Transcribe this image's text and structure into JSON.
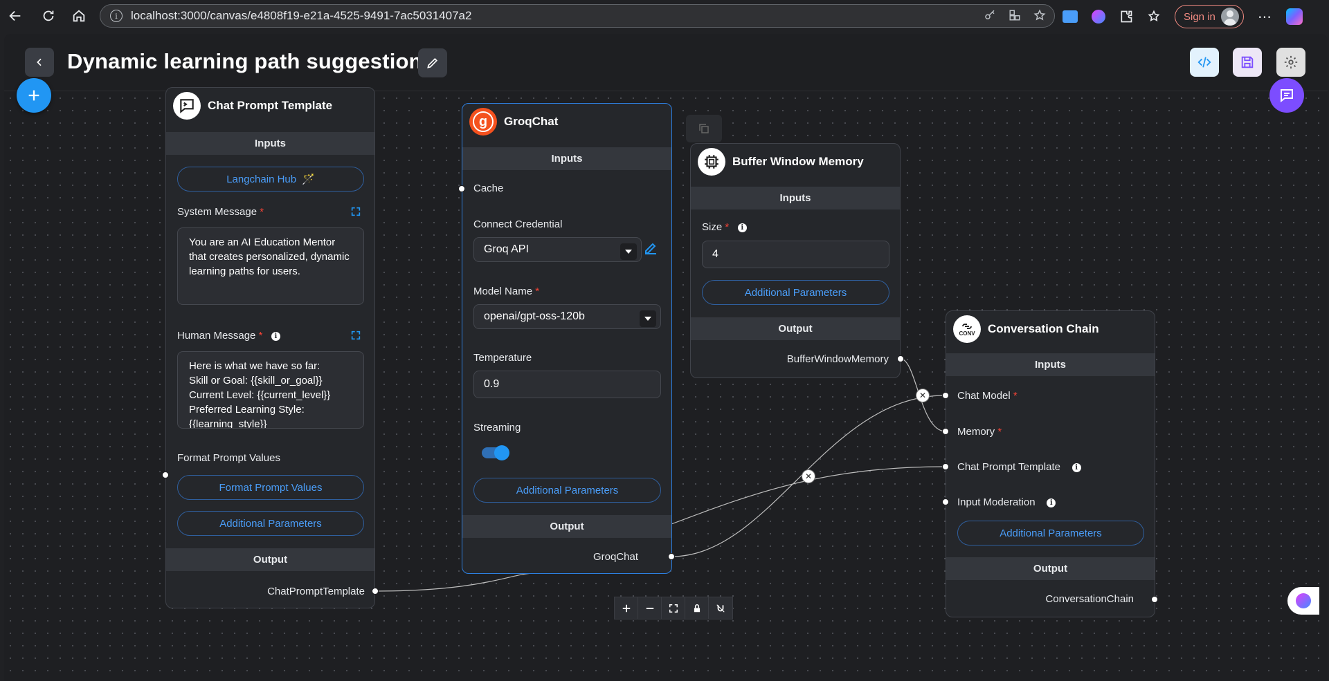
{
  "browser": {
    "url": "localhost:3000/canvas/e4808f19-e21a-4525-9491-7ac5031407a2",
    "signin_label": "Sign in"
  },
  "header": {
    "title": "Dynamic learning path suggestion"
  },
  "nodes": {
    "chat_prompt": {
      "title": "Chat Prompt Template",
      "inputs_label": "Inputs",
      "langchain_hub_label": "Langchain Hub",
      "system_message_label": "System Message",
      "system_message_value": "You are an AI Education Mentor that creates personalized, dynamic learning paths for users.",
      "human_message_label": "Human Message",
      "human_message_value": "Here is what we have so far:\nSkill or Goal: {{skill_or_goal}}\nCurrent Level: {{current_level}}\nPreferred Learning Style:\n{{learning_style}}",
      "format_prompt_label": "Format Prompt Values",
      "format_prompt_button": "Format Prompt Values",
      "additional_params": "Additional Parameters",
      "output_label": "Output",
      "output_name": "ChatPromptTemplate"
    },
    "groq": {
      "title": "GroqChat",
      "inputs_label": "Inputs",
      "cache_label": "Cache",
      "credential_label": "Connect Credential",
      "credential_value": "Groq API",
      "model_label": "Model Name",
      "model_value": "openai/gpt-oss-120b",
      "temperature_label": "Temperature",
      "temperature_value": "0.9",
      "streaming_label": "Streaming",
      "streaming_on": true,
      "additional_params": "Additional Parameters",
      "output_label": "Output",
      "output_name": "GroqChat"
    },
    "buffer": {
      "title": "Buffer Window Memory",
      "inputs_label": "Inputs",
      "size_label": "Size",
      "size_value": "4",
      "additional_params": "Additional Parameters",
      "output_label": "Output",
      "output_name": "BufferWindowMemory"
    },
    "conversation": {
      "title": "Conversation Chain",
      "icon_text": "CONV",
      "inputs_label": "Inputs",
      "chat_model_label": "Chat Model",
      "memory_label": "Memory",
      "chat_prompt_label": "Chat Prompt Template",
      "input_moderation_label": "Input Moderation",
      "additional_params": "Additional Parameters",
      "output_label": "Output",
      "output_name": "ConversationChain"
    }
  },
  "colors": {
    "accent": "#2196f3",
    "chat_fab": "#7c4dff",
    "required": "#f44336",
    "node_bg": "#25272b"
  }
}
